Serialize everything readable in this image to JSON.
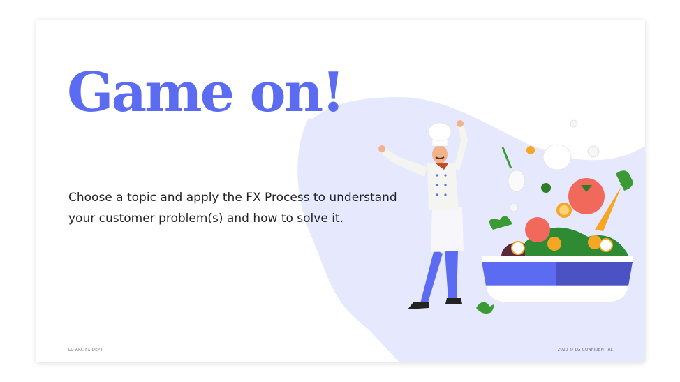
{
  "slide": {
    "title": "Game on!",
    "body": "Choose a topic and apply the FX Process to understand your customer problem(s) and how to solve it.",
    "footer_left": "LG ARC FX DEPT.",
    "footer_right": "2020 © LG CONFIDENTIAL"
  },
  "colors": {
    "accent": "#5c6cf2",
    "blob": "#e6e8fd",
    "text": "#222228"
  },
  "illustration": {
    "subject": "chef-with-vegetable-bowl"
  }
}
